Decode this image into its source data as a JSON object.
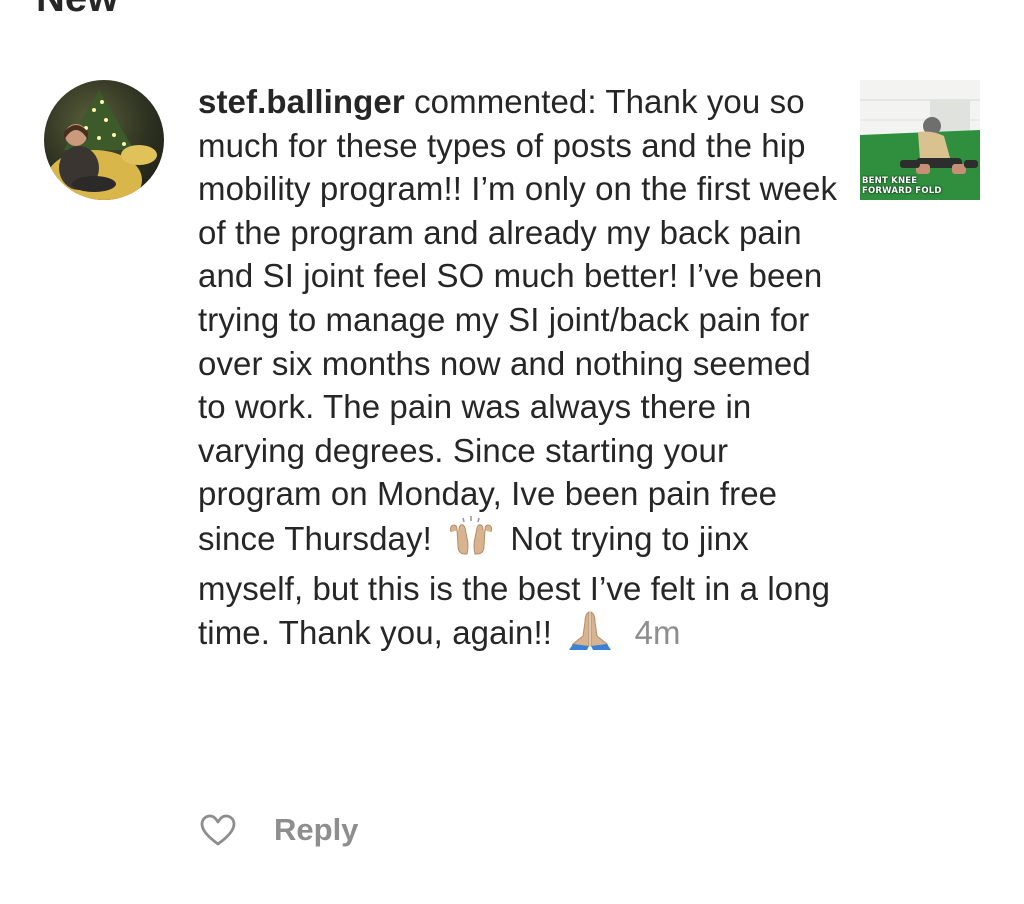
{
  "section": {
    "title": "New"
  },
  "comment": {
    "username": "stef.ballinger",
    "action": "commented:",
    "text_part1": "Thank you so much for these types of posts and the hip mobility program!! I’m only on the first week of the program and already my back pain and SI joint feel SO much better! I’ve been trying to manage my SI joint/back pain for over six months now and nothing seemed to work. The pain was always there in varying degrees. Since starting your program on Monday, Ive been pain free since Thursday!",
    "emoji1": "raising-hands-emoji",
    "text_part2": "Not trying to jinx myself, but this is the best I’ve felt in a long time. Thank you, again!!",
    "emoji2": "folded-hands-emoji",
    "timestamp": "4m"
  },
  "post_thumbnail": {
    "caption_line1": "BENT KNEE",
    "caption_line2": "FORWARD FOLD"
  },
  "actions": {
    "like_icon": "heart-outline-icon",
    "reply_label": "Reply"
  },
  "colors": {
    "text": "#262626",
    "secondary": "#8e8e8e",
    "background": "#ffffff"
  }
}
